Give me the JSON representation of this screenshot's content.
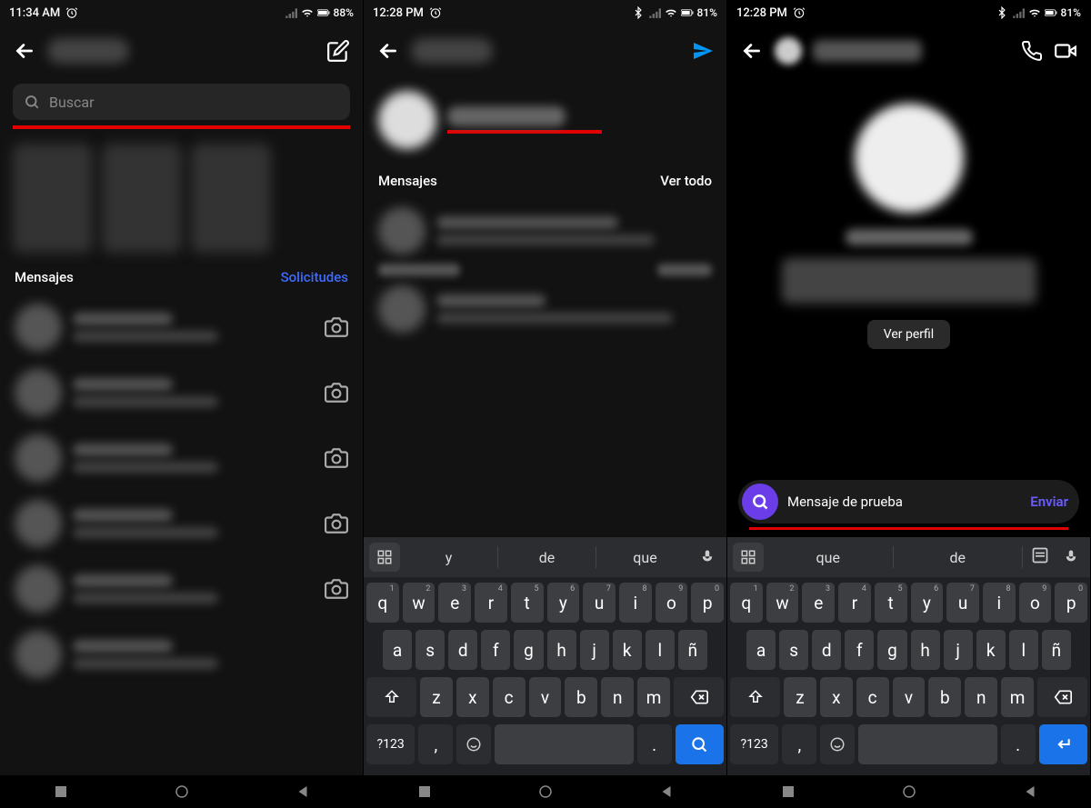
{
  "screen1": {
    "status": {
      "time": "11:34 AM",
      "battery": "88%"
    },
    "search": {
      "placeholder": "Buscar"
    },
    "sections": {
      "messages": "Mensajes",
      "requests": "Solicitudes"
    }
  },
  "screen2": {
    "status": {
      "time": "12:28 PM",
      "battery": "81%"
    },
    "sections": {
      "messages": "Mensajes",
      "viewAll": "Ver todo"
    },
    "suggestions": [
      "y",
      "de",
      "que"
    ],
    "keyboard": {
      "row1": [
        {
          "k": "q",
          "s": "1"
        },
        {
          "k": "w",
          "s": "2"
        },
        {
          "k": "e",
          "s": "3"
        },
        {
          "k": "r",
          "s": "4"
        },
        {
          "k": "t",
          "s": "5"
        },
        {
          "k": "y",
          "s": "6"
        },
        {
          "k": "u",
          "s": "7"
        },
        {
          "k": "i",
          "s": "8"
        },
        {
          "k": "o",
          "s": "9"
        },
        {
          "k": "p",
          "s": "0"
        }
      ],
      "row2": [
        "a",
        "s",
        "d",
        "f",
        "g",
        "h",
        "j",
        "k",
        "l",
        "ñ"
      ],
      "row3": [
        "z",
        "x",
        "c",
        "v",
        "b",
        "n",
        "m"
      ],
      "sym": "?123",
      "comma": ",",
      "dot": "."
    }
  },
  "screen3": {
    "status": {
      "time": "12:28 PM",
      "battery": "81%"
    },
    "viewProfile": "Ver perfil",
    "input": {
      "value": "Mensaje de prueba",
      "send": "Enviar"
    },
    "suggestions": [
      "que",
      "de"
    ],
    "keyboard": {
      "row1": [
        {
          "k": "q",
          "s": "1"
        },
        {
          "k": "w",
          "s": "2"
        },
        {
          "k": "e",
          "s": "3"
        },
        {
          "k": "r",
          "s": "4"
        },
        {
          "k": "t",
          "s": "5"
        },
        {
          "k": "y",
          "s": "6"
        },
        {
          "k": "u",
          "s": "7"
        },
        {
          "k": "i",
          "s": "8"
        },
        {
          "k": "o",
          "s": "9"
        },
        {
          "k": "p",
          "s": "0"
        }
      ],
      "row2": [
        "a",
        "s",
        "d",
        "f",
        "g",
        "h",
        "j",
        "k",
        "l",
        "ñ"
      ],
      "row3": [
        "z",
        "x",
        "c",
        "v",
        "b",
        "n",
        "m"
      ],
      "sym": "?123",
      "comma": ",",
      "dot": "."
    }
  }
}
